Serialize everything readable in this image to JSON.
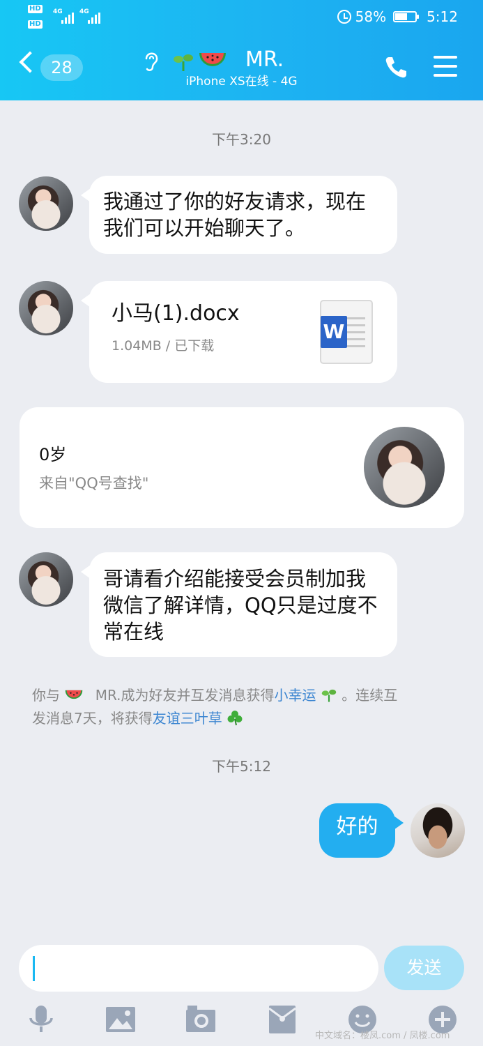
{
  "status_bar": {
    "hd1": "HD",
    "hd2": "HD",
    "net1": "4G",
    "net2": "4G",
    "battery": "58%",
    "time": "5:12"
  },
  "header": {
    "back_count": "28",
    "title": "MR.",
    "subtitle": "iPhone XS在线 - 4G"
  },
  "messages": {
    "time1": "下午3:20",
    "msg1": "我通过了你的好友请求，现在我们可以开始聊天了。",
    "file_name": "小马(1).docx",
    "file_meta": "1.04MB / 已下载",
    "card_age": "0岁",
    "card_source": "来自\"QQ号查找\"",
    "msg3": "哥请看介绍能接受会员制加我微信了解详情，QQ只是过度不常在线",
    "sys_prefix": "你与",
    "sys_mid": "MR.成为好友并互发消息获得",
    "sys_link1": "小幸运",
    "sys_after_link1": "。连续互",
    "sys_line2_prefix": "发消息7天，将获得",
    "sys_link2": "友谊三叶草",
    "time2": "下午5:12",
    "out_msg": "好的"
  },
  "input": {
    "value": "",
    "send_label": "发送"
  },
  "watermark": "中文域名：楼凤.com / 凤楼.com",
  "colors": {
    "header_start": "#17c7f4",
    "header_end": "#1aa6ef",
    "outgoing_bubble": "#23aef0",
    "link": "#3d86d1",
    "send_button": "#a8e2f8"
  }
}
